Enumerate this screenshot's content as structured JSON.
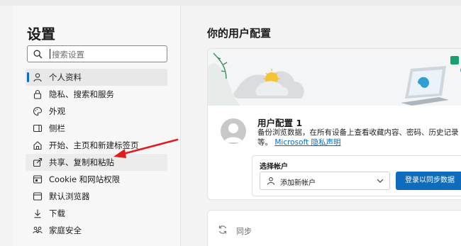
{
  "sidebar": {
    "title": "设置",
    "search": {
      "placeholder": "搜索设置"
    },
    "items": [
      {
        "label": "个人资料",
        "icon": "person-icon",
        "active": true
      },
      {
        "label": "隐私、搜索和服务",
        "icon": "lock-icon"
      },
      {
        "label": "外观",
        "icon": "palette-icon"
      },
      {
        "label": "侧栏",
        "icon": "sidebar-icon"
      },
      {
        "label": "开始、主页和新建标签页",
        "icon": "home-icon"
      },
      {
        "label": "共享、复制和粘贴",
        "icon": "share-icon",
        "hovered": true
      },
      {
        "label": "Cookie 和网站权限",
        "icon": "site-permissions-icon"
      },
      {
        "label": "默认浏览器",
        "icon": "browser-icon"
      },
      {
        "label": "下载",
        "icon": "download-icon"
      },
      {
        "label": "家庭安全",
        "icon": "family-icon"
      }
    ]
  },
  "main": {
    "title": "你的用户配置",
    "profile": {
      "name": "用户配置 1",
      "description": "备份浏览数据，在所有设备上查看收藏内容、密码、历史记录等。",
      "privacy_link": "Microsoft 隐私声明"
    },
    "sync_box": {
      "header": "选择帐户",
      "account_select": "添加新帐户",
      "signin_button": "登录以同步数据"
    },
    "sync_section": {
      "label": "同步"
    }
  },
  "colors": {
    "accent": "#0f6cbd",
    "annotation_arrow": "#e21c1c"
  }
}
